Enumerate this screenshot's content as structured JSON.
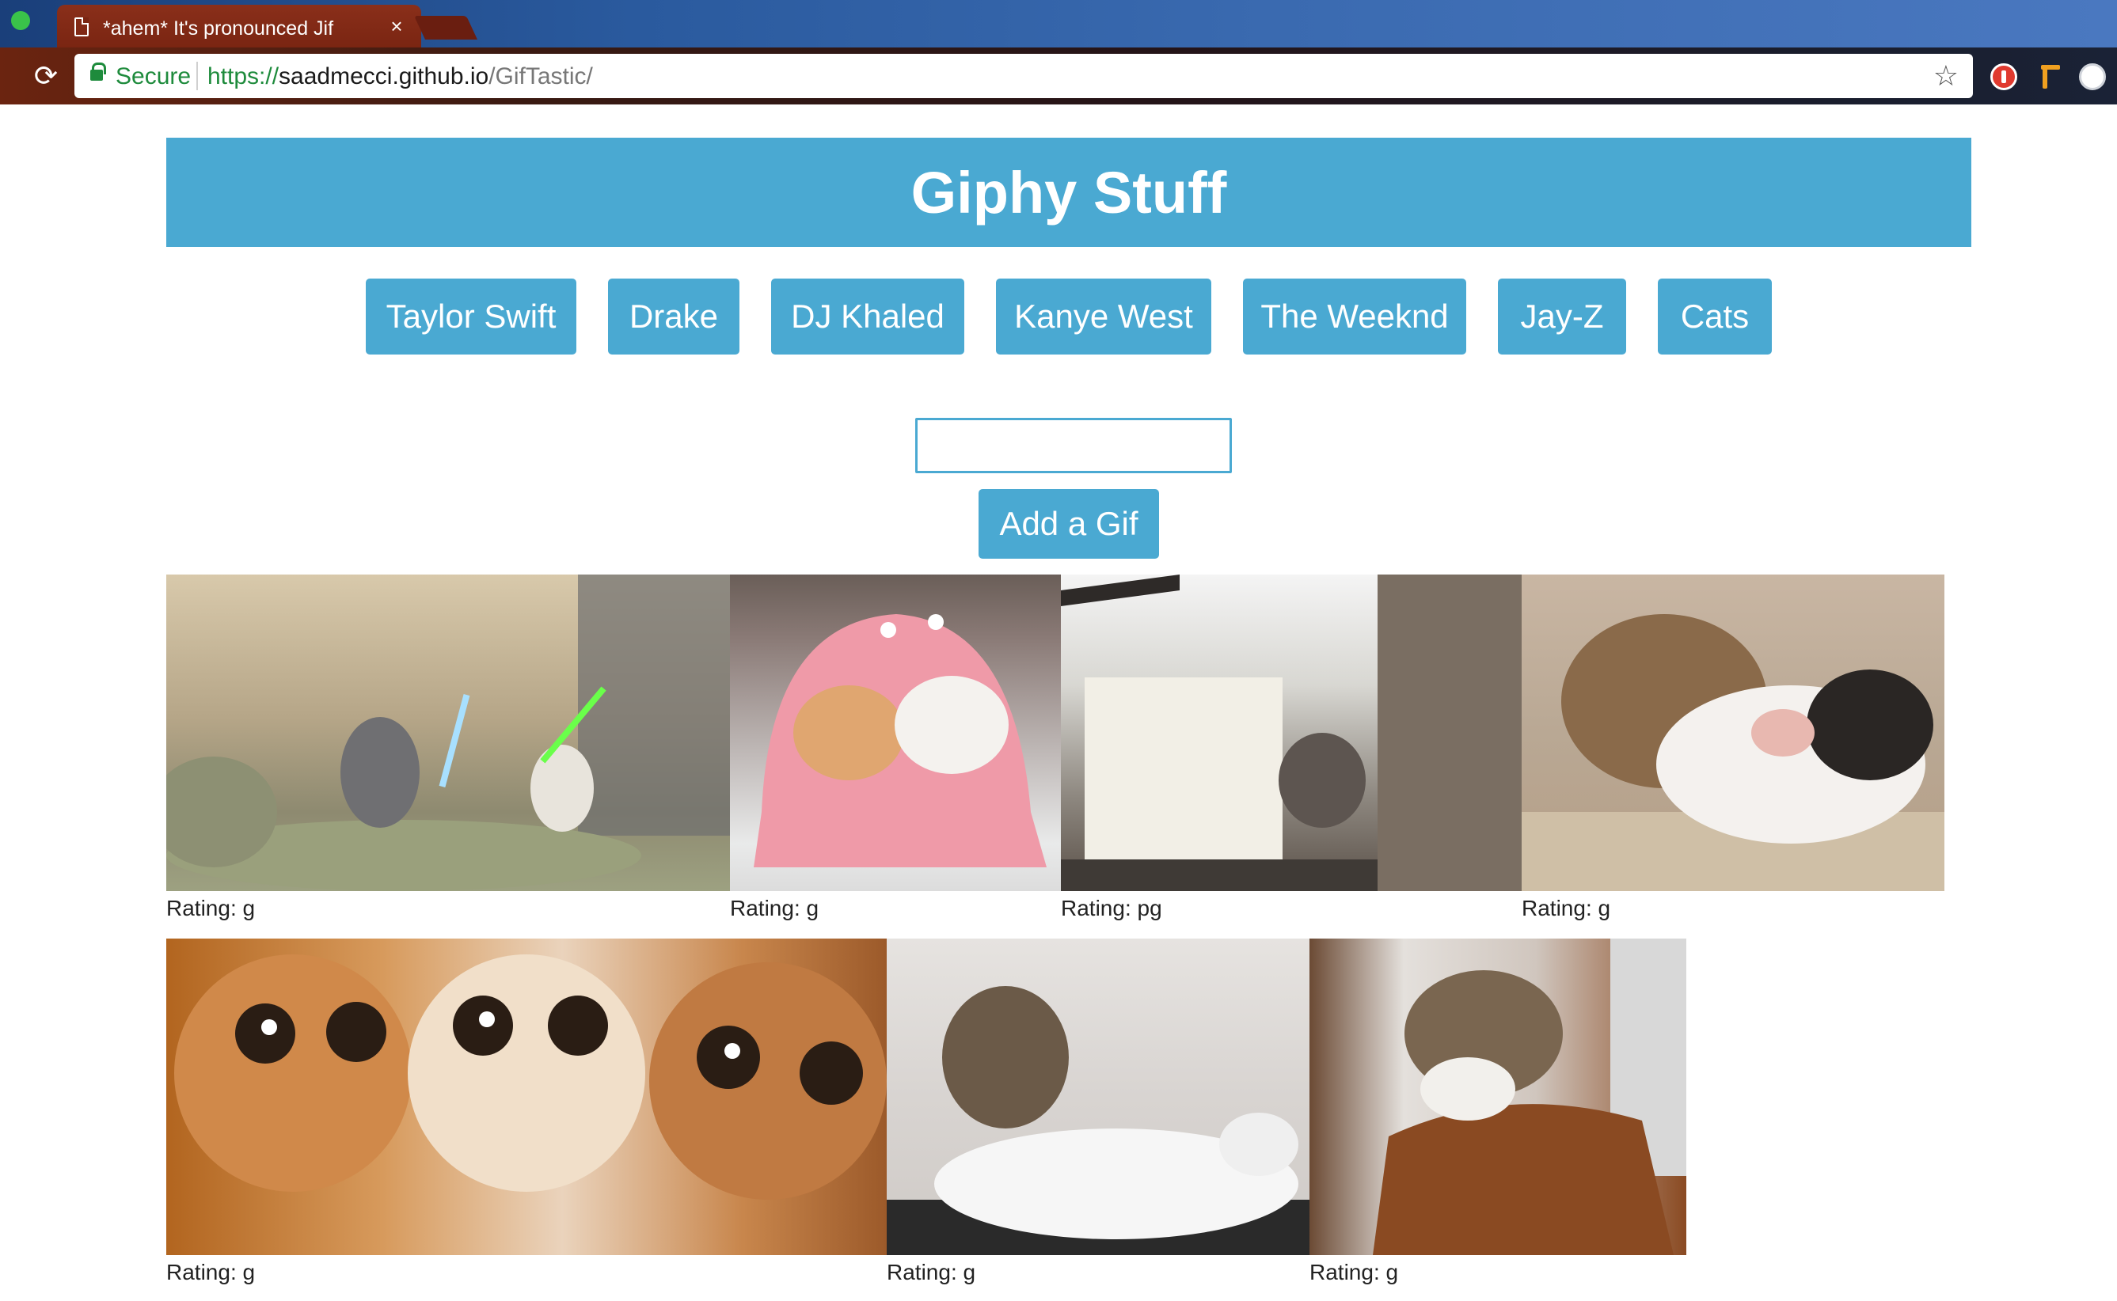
{
  "browser": {
    "tab_title": "*ahem* It's pronounced Jif",
    "tab_close": "×",
    "secure_label": "Secure",
    "url_scheme": "https://",
    "url_host": "saadmecci.github.io",
    "url_path": "/GifTastic/",
    "reload_glyph": "⟳",
    "star_glyph": "☆"
  },
  "page": {
    "title": "Giphy Stuff",
    "buttons": [
      {
        "label": "Taylor Swift"
      },
      {
        "label": "Drake"
      },
      {
        "label": "DJ Khaled"
      },
      {
        "label": "Kanye West"
      },
      {
        "label": "The Weeknd"
      },
      {
        "label": "Jay-Z"
      },
      {
        "label": "Cats"
      }
    ],
    "search": {
      "value": "",
      "placeholder": ""
    },
    "add_button_label": "Add a Gif",
    "gifs": [
      {
        "rating": "Rating: g"
      },
      {
        "rating": "Rating: g"
      },
      {
        "rating": "Rating: pg"
      },
      {
        "rating": "Rating: g"
      },
      {
        "rating": "Rating: g"
      },
      {
        "rating": "Rating: g"
      },
      {
        "rating": "Rating: g"
      }
    ]
  }
}
